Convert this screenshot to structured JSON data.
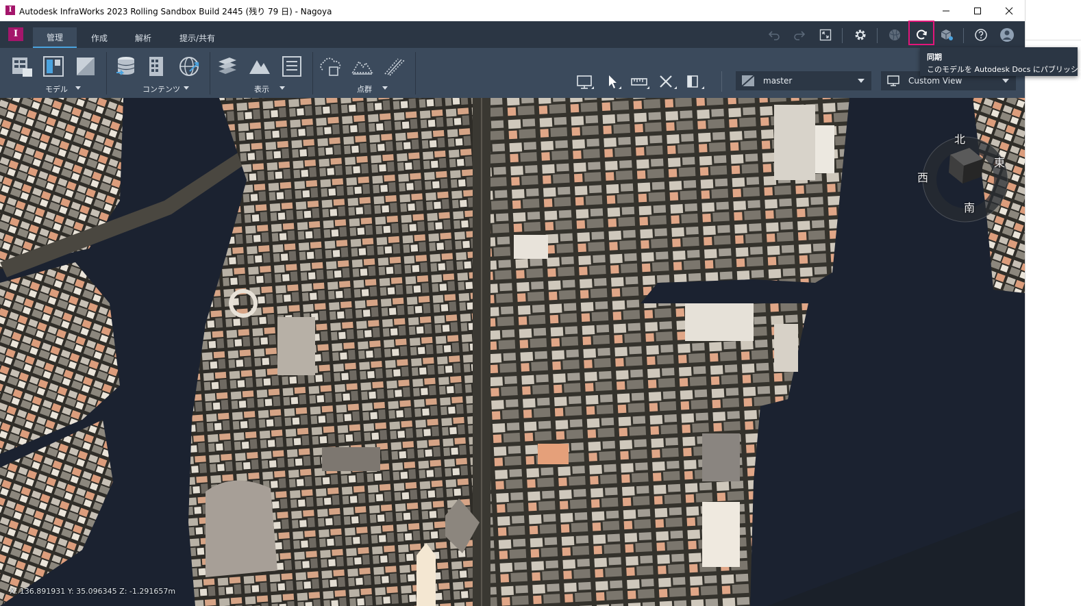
{
  "window": {
    "title": "Autodesk InfraWorks 2023 Rolling Sandbox Build 2445 (残り 79 日) - Nagoya",
    "app_icon_letter": "I",
    "controls": [
      "minimize-icon",
      "maximize-icon",
      "close-icon"
    ]
  },
  "tabs": [
    {
      "label": "管理",
      "active": true
    },
    {
      "label": "作成",
      "active": false
    },
    {
      "label": "解析",
      "active": false
    },
    {
      "label": "提示/共有",
      "active": false
    }
  ],
  "quick_toolbar": [
    "undo-icon",
    "redo-icon",
    "fit-view-icon",
    "settings-gear-icon",
    "globe-icon",
    "sync-icon",
    "publish-cube-icon",
    "help-icon",
    "user-avatar-icon"
  ],
  "ribbon": {
    "groups": [
      {
        "label": "モデル",
        "icons": [
          "model-browser-icon",
          "model-panel-icon",
          "style-palette-icon"
        ]
      },
      {
        "label": "コンテンツ",
        "icons": [
          "data-sources-icon",
          "buildings-icon",
          "globe-import-icon"
        ]
      },
      {
        "label": "表示",
        "icons": [
          "layers-icon",
          "terrain-icon",
          "list-panel-icon"
        ]
      },
      {
        "label": "点群",
        "icons": [
          "pointcloud-cloud-icon",
          "pointcloud-terrain-icon",
          "pointcloud-road-icon"
        ]
      }
    ],
    "view_tools": [
      "display-mode-icon",
      "select-pointer-icon",
      "measure-icon",
      "tools-cross-icon",
      "split-view-icon"
    ],
    "proposal_dropdown": {
      "value": "master"
    },
    "view_dropdown": {
      "value": "Custom View"
    }
  },
  "tooltip": {
    "title": "同期",
    "description": "このモデルを Autodesk Docs にパブリッシュ"
  },
  "compass": {
    "north": "北",
    "east": "東",
    "south": "南",
    "west": "西"
  },
  "status": {
    "coordinates": "X: 136.891931 Y: 35.096345 Z: -1.291657m"
  },
  "colors": {
    "accent_magenta": "#a4166b",
    "highlight_pink": "#e3157a",
    "ribbon_bg": "#3b4a5c",
    "tabbar_bg": "#2b3644",
    "water": "#1b2230"
  }
}
